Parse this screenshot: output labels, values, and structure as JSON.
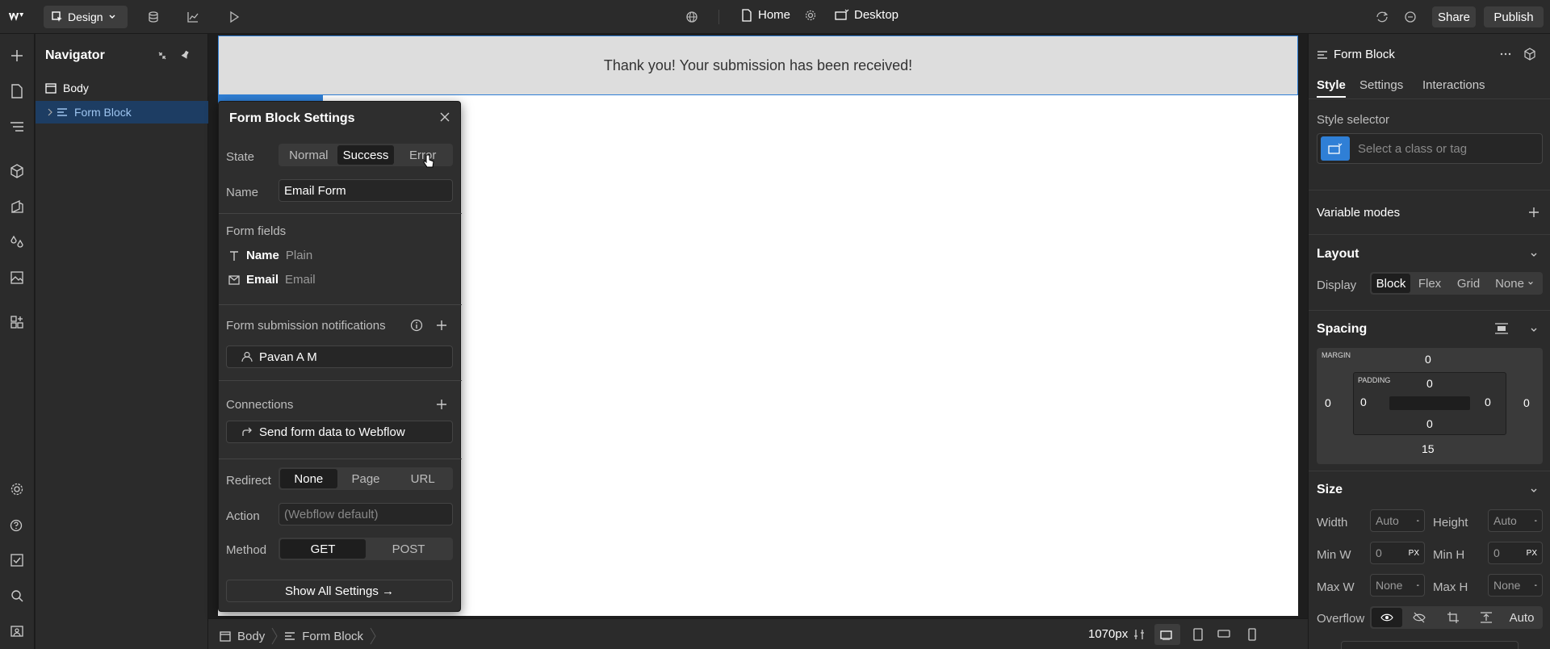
{
  "topbar": {
    "mode_label": "Design",
    "page_label": "Home",
    "breakpoint_label": "Desktop",
    "share_label": "Share",
    "publish_label": "Publish"
  },
  "navigator": {
    "title": "Navigator",
    "items": [
      {
        "label": "Body"
      },
      {
        "label": "Form Block"
      }
    ]
  },
  "canvas": {
    "success_message": "Thank you! Your submission has been received!"
  },
  "form_settings": {
    "title": "Form Block Settings",
    "state_label": "State",
    "states": [
      "Normal",
      "Success",
      "Error"
    ],
    "active_state": "Success",
    "name_label": "Name",
    "name_value": "Email Form",
    "form_fields_label": "Form fields",
    "fields": [
      {
        "name": "Name",
        "type": "Plain"
      },
      {
        "name": "Email",
        "type": "Email"
      }
    ],
    "notifications_label": "Form submission notifications",
    "notification_user": "Pavan A M",
    "connections_label": "Connections",
    "connection_item": "Send form data to Webflow",
    "redirect_label": "Redirect",
    "redirect_options": [
      "None",
      "Page",
      "URL"
    ],
    "redirect_selected": "None",
    "action_label": "Action",
    "action_placeholder": "(Webflow default)",
    "method_label": "Method",
    "method_options": [
      "GET",
      "POST"
    ],
    "method_selected": "GET",
    "show_all_label": "Show All Settings →"
  },
  "bottombar": {
    "breadcrumb": [
      "Body",
      "Form Block"
    ],
    "width_label": "1070px"
  },
  "right_panel": {
    "element_name": "Form Block",
    "tabs": [
      "Style",
      "Settings",
      "Interactions"
    ],
    "active_tab": "Style",
    "style_selector_label": "Style selector",
    "style_selector_placeholder": "Select a class or tag",
    "variable_modes_label": "Variable modes",
    "layout_label": "Layout",
    "display_label": "Display",
    "display_options": [
      "Block",
      "Flex",
      "Grid",
      "None"
    ],
    "display_selected": "Block",
    "spacing_label": "Spacing",
    "margin_label": "MARGIN",
    "padding_label": "PADDING",
    "margin": {
      "top": "0",
      "right": "0",
      "bottom": "15",
      "left": "0"
    },
    "padding": {
      "top": "0",
      "right": "0",
      "bottom": "0",
      "left": "0"
    },
    "size_label": "Size",
    "width_label": "Width",
    "width_value": "Auto",
    "height_label": "Height",
    "height_value": "Auto",
    "min_w_label": "Min W",
    "min_w_value": "0",
    "min_h_label": "Min H",
    "min_h_value": "0",
    "max_w_label": "Max W",
    "max_w_value": "None",
    "max_h_label": "Max H",
    "max_h_value": "None",
    "unit_px": "PX",
    "dash": "-",
    "overflow_label": "Overflow",
    "overflow_auto": "Auto"
  },
  "colors": {
    "accent": "#2f7fd6",
    "panel_bg": "#2b2b2b",
    "canvas_bg": "#ffffff"
  }
}
